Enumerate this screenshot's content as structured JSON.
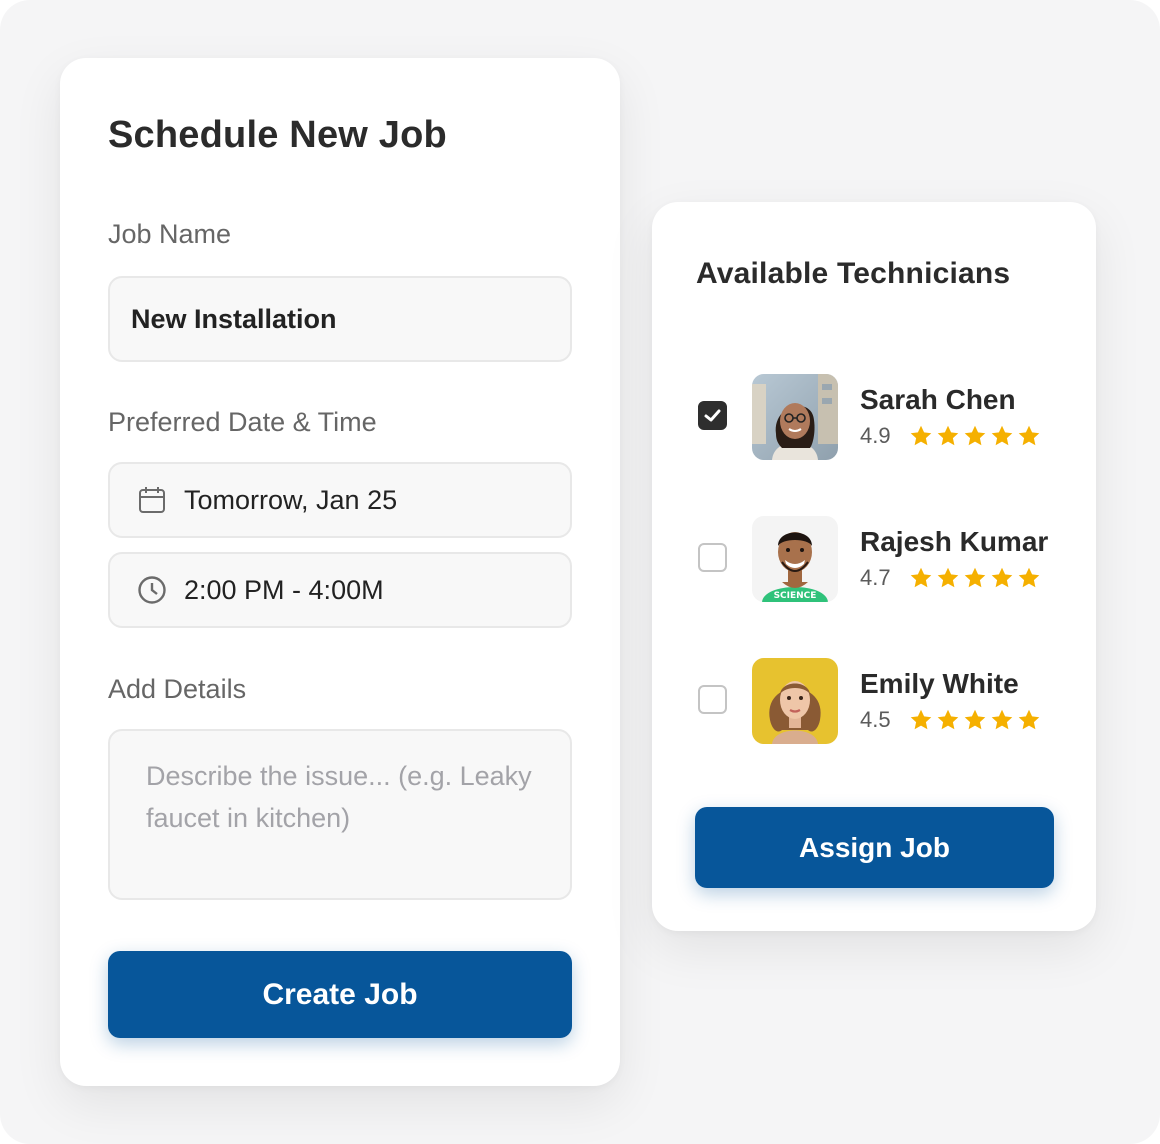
{
  "schedule_form": {
    "title": "Schedule New Job",
    "job_name_label": "Job Name",
    "job_name_value": "New Installation",
    "datetime_label": "Preferred Date & Time",
    "date_value": "Tomorrow, Jan 25",
    "time_value": "2:00 PM - 4:00M",
    "details_label": "Add Details",
    "details_placeholder": "Describe the issue... (e.g. Leaky faucet in kitchen)",
    "create_button_label": "Create Job",
    "icons": {
      "date": "calendar-icon",
      "time": "clock-icon"
    }
  },
  "technicians_panel": {
    "title": "Available Technicians",
    "technicians": [
      {
        "name": "Sarah Chen",
        "rating": "4.9",
        "stars": 5,
        "selected": true
      },
      {
        "name": "Rajesh Kumar",
        "rating": "4.7",
        "stars": 5,
        "selected": false
      },
      {
        "name": "Emily White",
        "rating": "4.5",
        "stars": 5,
        "selected": false
      }
    ],
    "assign_button_label": "Assign Job"
  },
  "colors": {
    "primary": "#07569a",
    "star": "#f5b000",
    "checkbox_checked": "#2e2e2e",
    "background": "#f5f5f6"
  }
}
